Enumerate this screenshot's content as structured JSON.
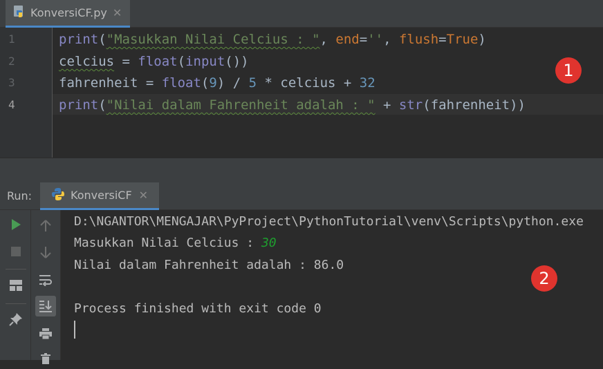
{
  "editor": {
    "tab": {
      "filename": "KonversiCF.py",
      "close": "✕"
    },
    "lines": [
      {
        "number": "1"
      },
      {
        "number": "2"
      },
      {
        "number": "3"
      },
      {
        "number": "4"
      }
    ],
    "code": {
      "l1": {
        "fn": "print",
        "p1": "(",
        "str": "\"Masukkan Nilai Celcius : \"",
        "c1": ", ",
        "end_kw": "end",
        "eq1": "=",
        "end_val": "''",
        "c2": ", ",
        "flush_kw": "flush",
        "eq2": "=",
        "flush_val": "True",
        "p2": ")"
      },
      "l2": {
        "var": "celcius",
        "op": " = ",
        "fn1": "float",
        "p1": "(",
        "fn2": "input",
        "p2": "())"
      },
      "l3": {
        "var": "fahrenheit",
        "op": " = ",
        "fn": "float",
        "p1": "(",
        "n1": "9",
        "p2": ")",
        "op2": " / ",
        "n2": "5",
        "op3": " * celcius + ",
        "n3": "32"
      },
      "l4": {
        "fn": "print",
        "p1": "(",
        "str": "\"Nilai dalam Fahrenheit adalah : \"",
        "op": " + ",
        "fn2": "str",
        "p2": "(fahrenheit))"
      }
    }
  },
  "run": {
    "label": "Run:",
    "tab": {
      "name": "KonversiCF",
      "close": "✕"
    },
    "console": {
      "line1": "D:\\NGANTOR\\MENGAJAR\\PyProject\\PythonTutorial\\venv\\Scripts\\python.exe",
      "line2_prompt": "Masukkan Nilai Celcius : ",
      "line2_input": "30",
      "line3": "Nilai dalam Fahrenheit adalah : 86.0",
      "line4": "",
      "line5": "Process finished with exit code 0"
    }
  },
  "markers": {
    "m1": "1",
    "m2": "2"
  },
  "icons": [
    "python-file-icon",
    "run-icon",
    "stop-icon",
    "layout-icon",
    "pin-icon",
    "up-arrow-icon",
    "down-arrow-icon",
    "soft-wrap-icon",
    "scroll-to-end-icon",
    "print-icon",
    "trash-icon",
    "python-icon"
  ],
  "colors": {
    "accent": "#4a88c7",
    "run_green": "#499c54",
    "marker_red": "#e0342e"
  }
}
